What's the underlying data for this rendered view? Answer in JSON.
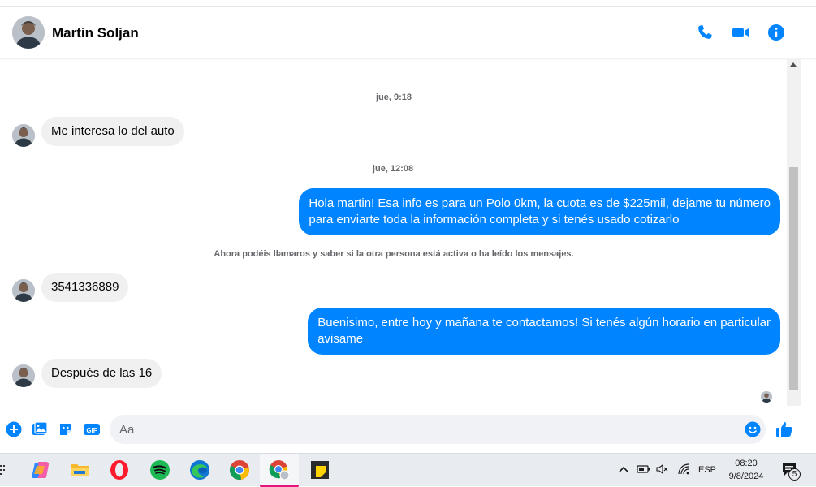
{
  "contact": {
    "name": "Martin Soljan"
  },
  "messages": {
    "ts1": "jue, 9:18",
    "in1": "Me interesa lo del auto",
    "ts2": "jue, 12:08",
    "out1_line1": "Hola martin! Esa info es para un Polo 0km, la cuota es de $225mil, dejame tu número",
    "out1_line2": "para enviarte toda la información completa y si tenés usado cotizarlo",
    "notice": "Ahora podéis llamaros y saber si la otra persona está activa o ha leído los mensajes.",
    "in2": "3541336889",
    "out2_line1": "Buenisimo, entre hoy y mañana te contactamos! Si tenés algún horario en particular",
    "out2_line2": "avisame",
    "in3": "Después de las 16"
  },
  "composer": {
    "placeholder": "Aa"
  },
  "taskbar": {
    "language": "ESP",
    "time": "08:20",
    "date": "9/8/2024",
    "notifications": "5"
  },
  "icons": {
    "header": [
      "phone-icon",
      "video-icon",
      "info-icon"
    ],
    "composer": [
      "plus-icon",
      "image-icon",
      "sticker-icon",
      "gif-icon",
      "emoji-icon",
      "thumbs-up-icon"
    ],
    "taskbar_apps": [
      "copilot-icon",
      "file-explorer-icon",
      "opera-icon",
      "spotify-icon",
      "edge-icon",
      "chrome-icon",
      "chrome-profile-icon",
      "sticky-notes-icon"
    ]
  },
  "colors": {
    "accent": "#0084ff",
    "incoming_bubble": "#f0f0f0"
  }
}
